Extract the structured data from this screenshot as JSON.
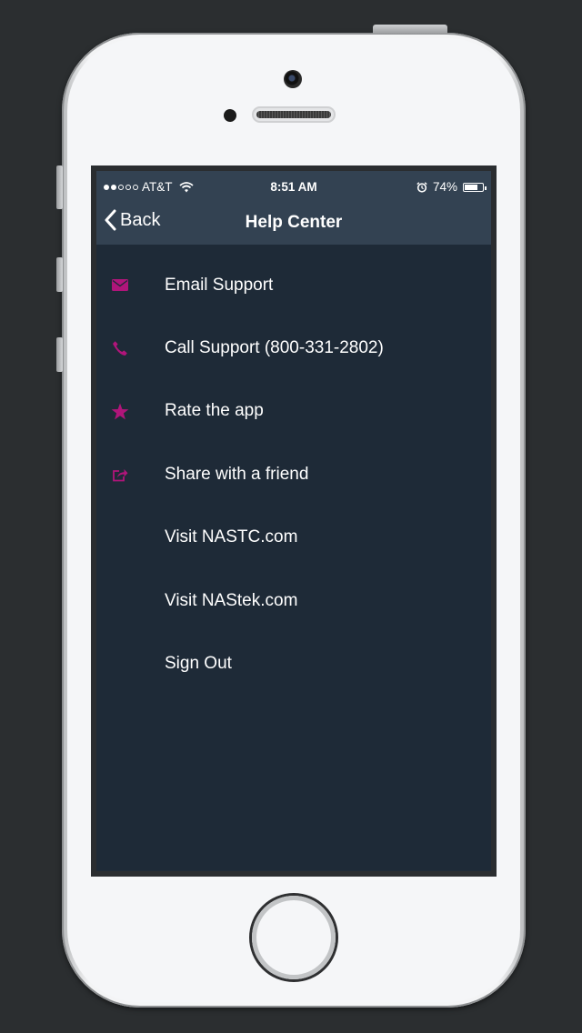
{
  "status_bar": {
    "signal_full": 2,
    "signal_total": 5,
    "carrier": "AT&T",
    "time": "8:51 AM",
    "battery": "74%",
    "battery_level": 0.74
  },
  "nav": {
    "back_label": "Back",
    "title": "Help Center"
  },
  "colors": {
    "accent": "#b0157a",
    "header_bg": "#334252",
    "content_bg": "#1e2a37"
  },
  "menu": {
    "items": [
      {
        "label": "Email Support",
        "icon": "mail-icon"
      },
      {
        "label": "Call Support (800-331-2802)",
        "icon": "phone-icon"
      },
      {
        "label": "Rate the app",
        "icon": "star-icon"
      },
      {
        "label": "Share with a friend",
        "icon": "share-icon"
      },
      {
        "label": "Visit NASTC.com",
        "icon": ""
      },
      {
        "label": "Visit NAStek.com",
        "icon": ""
      },
      {
        "label": "Sign Out",
        "icon": ""
      }
    ]
  }
}
